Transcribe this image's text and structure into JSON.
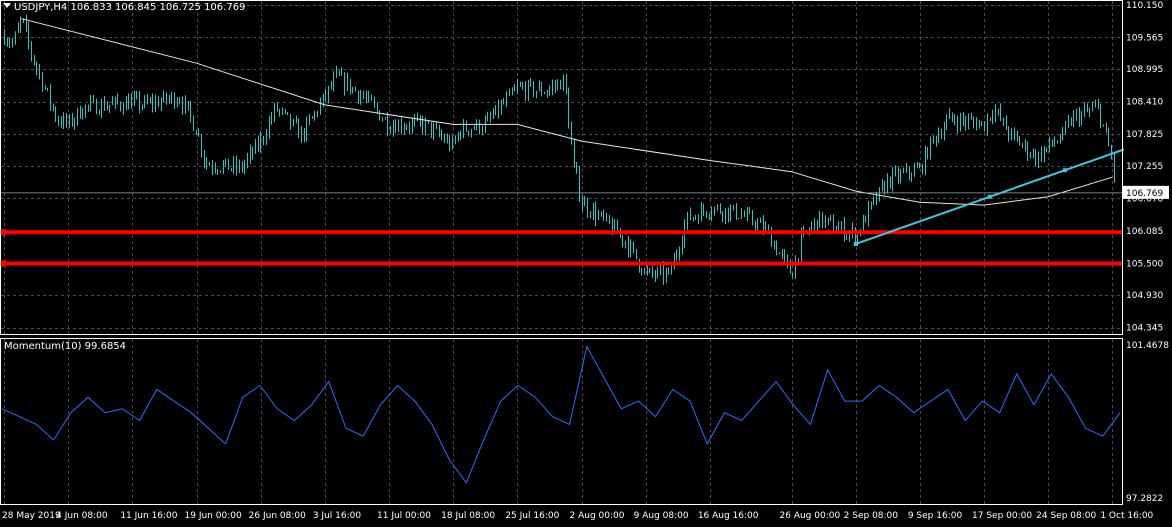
{
  "window": {
    "price_header": "USDJPY,H4  106.833 106.845 106.725 106.769",
    "indicator_header": "Momentum(10) 99.6854"
  },
  "colors": {
    "background": "#000000",
    "grid": "#4a4a4a",
    "candles": "#2ec4c4",
    "moving_average": "#e6e6e6",
    "trendline": "#3ec8e0",
    "support_lines": "#ff0000",
    "momentum": "#2f6bff",
    "text": "#ffffff",
    "current_price_label_bg": "#ffffff",
    "current_price_label_fg": "#000000"
  },
  "chart_data": [
    {
      "type": "candlestick",
      "symbol": "USDJPY",
      "timeframe": "H4",
      "ylim": [
        104.25,
        110.2
      ],
      "y_ticks": [
        "110.150",
        "109.565",
        "108.995",
        "108.410",
        "107.825",
        "107.255",
        "106.670",
        "106.085",
        "105.500",
        "104.930",
        "104.345"
      ],
      "x_ticks": [
        "28 May 2019",
        "4 Jun 08:00",
        "11 Jun 16:00",
        "19 Jun 00:00",
        "26 Jun 08:00",
        "3 Jul 16:00",
        "11 Jul 00:00",
        "18 Jul 08:00",
        "25 Jul 16:00",
        "2 Aug 00:00",
        "9 Aug 08:00",
        "16 Aug 16:00",
        "26 Aug 00:00",
        "2 Sep 08:00",
        "9 Sep 16:00",
        "17 Sep 00:00",
        "24 Sep 08:00",
        "1 Oct 16:00"
      ],
      "price_path": [
        {
          "x": "28 May 2019",
          "y": 109.6
        },
        {
          "x": "29 May 2019",
          "y": 109.45
        },
        {
          "x": "30 May 2019",
          "y": 109.9
        },
        {
          "x": "31 May 2019",
          "y": 109.3
        },
        {
          "x": "3 Jun 2019",
          "y": 108.1
        },
        {
          "x": "4 Jun 08:00",
          "y": 108.0
        },
        {
          "x": "6 Jun 2019",
          "y": 108.3
        },
        {
          "x": "11 Jun 16:00",
          "y": 108.4
        },
        {
          "x": "13 Jun 2019",
          "y": 108.35
        },
        {
          "x": "17 Jun 2019",
          "y": 108.5
        },
        {
          "x": "19 Jun 00:00",
          "y": 107.9
        },
        {
          "x": "20 Jun 2019",
          "y": 107.3
        },
        {
          "x": "24 Jun 2019",
          "y": 107.2
        },
        {
          "x": "26 Jun 08:00",
          "y": 107.7
        },
        {
          "x": "28 Jun 2019",
          "y": 108.3
        },
        {
          "x": "1 Jul 2019",
          "y": 107.8
        },
        {
          "x": "3 Jul 16:00",
          "y": 108.5
        },
        {
          "x": "5 Jul 2019",
          "y": 108.85
        },
        {
          "x": "8 Jul 2019",
          "y": 108.5
        },
        {
          "x": "11 Jul 00:00",
          "y": 108.0
        },
        {
          "x": "15 Jul 2019",
          "y": 108.0
        },
        {
          "x": "18 Jul 08:00",
          "y": 107.6
        },
        {
          "x": "19 Jul 2019",
          "y": 107.9
        },
        {
          "x": "22 Jul 2019",
          "y": 108.0
        },
        {
          "x": "25 Jul 16:00",
          "y": 108.65
        },
        {
          "x": "29 Jul 2019",
          "y": 108.6
        },
        {
          "x": "31 Jul 2019",
          "y": 108.8
        },
        {
          "x": "1 Aug 2019",
          "y": 107.3
        },
        {
          "x": "2 Aug 00:00",
          "y": 106.6
        },
        {
          "x": "5 Aug 2019",
          "y": 106.2
        },
        {
          "x": "7 Aug 2019",
          "y": 105.9
        },
        {
          "x": "9 Aug 08:00",
          "y": 105.3
        },
        {
          "x": "12 Aug 2019",
          "y": 105.3
        },
        {
          "x": "14 Aug 2019",
          "y": 106.3
        },
        {
          "x": "16 Aug 16:00",
          "y": 106.5
        },
        {
          "x": "20 Aug 2019",
          "y": 106.4
        },
        {
          "x": "23 Aug 2019",
          "y": 106.1
        },
        {
          "x": "26 Aug 00:00",
          "y": 105.3
        },
        {
          "x": "27 Aug 2019",
          "y": 105.9
        },
        {
          "x": "29 Aug 2019",
          "y": 106.3
        },
        {
          "x": "2 Sep 08:00",
          "y": 106.0
        },
        {
          "x": "4 Sep 2019",
          "y": 106.5
        },
        {
          "x": "6 Sep 2019",
          "y": 107.0
        },
        {
          "x": "9 Sep 16:00",
          "y": 107.2
        },
        {
          "x": "11 Sep 2019",
          "y": 107.7
        },
        {
          "x": "13 Sep 2019",
          "y": 108.1
        },
        {
          "x": "17 Sep 00:00",
          "y": 108.0
        },
        {
          "x": "18 Sep 2019",
          "y": 108.3
        },
        {
          "x": "20 Sep 2019",
          "y": 107.8
        },
        {
          "x": "23 Sep 2019",
          "y": 107.4
        },
        {
          "x": "24 Sep 08:00",
          "y": 107.6
        },
        {
          "x": "26 Sep 2019",
          "y": 107.8
        },
        {
          "x": "27 Sep 2019",
          "y": 108.1
        },
        {
          "x": "30 Sep 2019",
          "y": 108.3
        },
        {
          "x": "1 Oct 16:00",
          "y": 107.3
        },
        {
          "x": "2 Oct 2019",
          "y": 106.77
        }
      ],
      "current_price": "106.769",
      "current_price_value": 106.769,
      "horizontal_levels": [
        106.06,
        105.5
      ],
      "trendline": {
        "from": {
          "x": "2 Sep 08:00",
          "y": 105.85
        },
        "to": {
          "x": "3 Oct 2019",
          "y": 107.55
        }
      },
      "moving_average": [
        {
          "x": "30 May 2019",
          "y": 109.9
        },
        {
          "x": "19 Jun 00:00",
          "y": 109.1
        },
        {
          "x": "3 Jul 16:00",
          "y": 108.35
        },
        {
          "x": "18 Jul 08:00",
          "y": 108.0
        },
        {
          "x": "25 Jul 16:00",
          "y": 108.0
        },
        {
          "x": "2 Aug 00:00",
          "y": 107.7
        },
        {
          "x": "16 Aug 16:00",
          "y": 107.35
        },
        {
          "x": "26 Aug 00:00",
          "y": 107.15
        },
        {
          "x": "2 Sep 08:00",
          "y": 106.8
        },
        {
          "x": "9 Sep 16:00",
          "y": 106.6
        },
        {
          "x": "17 Sep 00:00",
          "y": 106.55
        },
        {
          "x": "24 Sep 08:00",
          "y": 106.7
        },
        {
          "x": "1 Oct 16:00",
          "y": 107.05
        }
      ]
    },
    {
      "type": "line",
      "name": "Momentum(10)",
      "ylim": [
        97.2822,
        101.4678
      ],
      "y_ticks": [
        "101.4678",
        "97.2822"
      ],
      "last_value": 99.6854,
      "values": [
        99.7,
        99.5,
        99.3,
        98.9,
        99.6,
        100.0,
        99.6,
        99.7,
        99.4,
        100.2,
        99.9,
        99.6,
        99.2,
        98.8,
        100.0,
        100.3,
        99.7,
        99.4,
        99.8,
        100.4,
        99.2,
        99.0,
        99.8,
        100.3,
        99.9,
        99.3,
        98.4,
        97.8,
        98.9,
        99.9,
        100.3,
        100.0,
        99.5,
        99.3,
        101.3,
        100.5,
        99.7,
        99.9,
        99.5,
        100.2,
        99.9,
        98.8,
        99.6,
        99.4,
        99.9,
        100.4,
        99.8,
        99.3,
        100.7,
        99.9,
        99.9,
        100.3,
        100.0,
        99.6,
        99.9,
        100.2,
        99.4,
        99.9,
        99.6,
        100.6,
        99.8,
        100.6,
        100.0,
        99.2,
        99.0,
        99.6
      ]
    }
  ]
}
